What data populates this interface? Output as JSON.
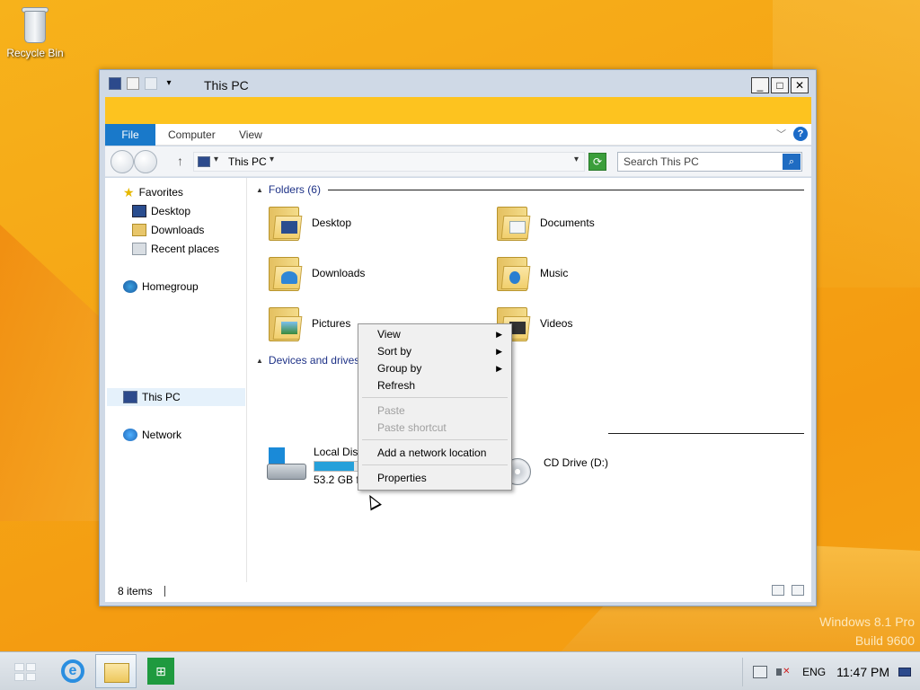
{
  "desktop": {
    "recycle_bin_label": "Recycle Bin",
    "watermark_line1": "Windows 8.1 Pro",
    "watermark_line2": "Build 9600"
  },
  "window": {
    "title": "This PC",
    "ribbon_tabs": [
      "File",
      "Computer",
      "View"
    ],
    "address": "This PC",
    "search_placeholder": "Search This PC",
    "nav_pane": {
      "favorites": "Favorites",
      "favorites_items": [
        "Desktop",
        "Downloads",
        "Recent places"
      ],
      "homegroup": "Homegroup",
      "this_pc": "This PC",
      "network": "Network"
    },
    "folders_group": "Folders (6)",
    "folders": [
      "Desktop",
      "Documents",
      "Downloads",
      "Music",
      "Pictures",
      "Videos"
    ],
    "devices_group": "Devices and drives",
    "drives": [
      {
        "name": "Local Disk",
        "free": "53.2 GB fr",
        "used_fraction": 0.45
      },
      {
        "name": "CD Drive (D:)"
      }
    ],
    "status_count": "8 items"
  },
  "context_menu": {
    "items": [
      {
        "label": "View",
        "submenu": true,
        "enabled": true
      },
      {
        "label": "Sort by",
        "submenu": true,
        "enabled": true
      },
      {
        "label": "Group by",
        "submenu": true,
        "enabled": true
      },
      {
        "label": "Refresh",
        "submenu": false,
        "enabled": true
      },
      {
        "label": "Paste",
        "submenu": false,
        "enabled": false
      },
      {
        "label": "Paste shortcut",
        "submenu": false,
        "enabled": false
      },
      {
        "label": "Add a network location",
        "submenu": false,
        "enabled": true
      },
      {
        "label": "Properties",
        "submenu": false,
        "enabled": true
      }
    ]
  },
  "taskbar": {
    "language": "ENG",
    "clock": "11:47 PM",
    "pinned": [
      "start-icon",
      "internet-explorer-icon",
      "file-explorer-icon",
      "store-icon"
    ]
  },
  "colors": {
    "accent_file_tab": "#1979ca",
    "ribbon_band": "#fdc31f",
    "desktop_orange": "#f5a515"
  }
}
